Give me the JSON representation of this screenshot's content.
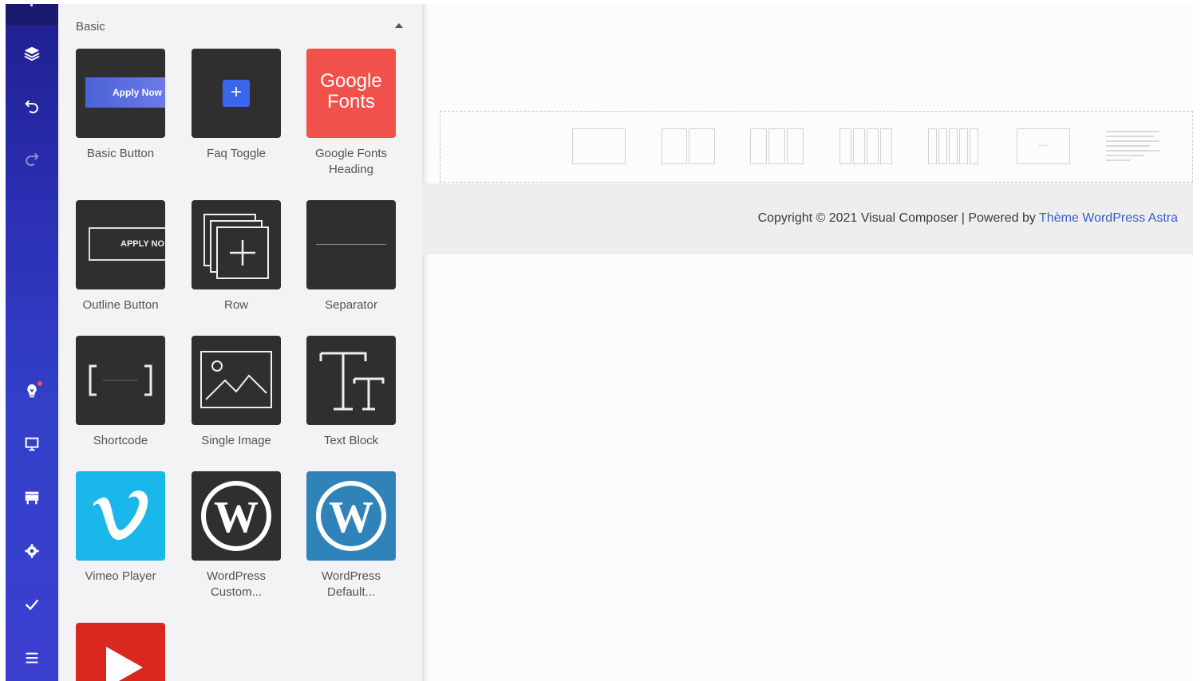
{
  "panel": {
    "section_title": "Basic",
    "elements": [
      {
        "label": "Basic Button",
        "thumb_text": "Apply Now"
      },
      {
        "label": "Faq Toggle",
        "thumb_text": "+"
      },
      {
        "label": "Google Fonts Heading",
        "thumb_text_line1": "Google",
        "thumb_text_line2": "Fonts"
      },
      {
        "label": "Outline Button",
        "thumb_text": "APPLY NO"
      },
      {
        "label": "Row"
      },
      {
        "label": "Separator"
      },
      {
        "label": "Shortcode"
      },
      {
        "label": "Single Image"
      },
      {
        "label": "Text Block"
      },
      {
        "label": "Vimeo Player"
      },
      {
        "label": "WordPress Custom..."
      },
      {
        "label": "WordPress Default..."
      },
      {
        "label": ""
      }
    ]
  },
  "navbar": {
    "icons": [
      "layers-icon",
      "undo-icon",
      "redo-icon",
      "lightbulb-icon",
      "desktop-icon",
      "shop-icon",
      "settings-icon",
      "check-icon",
      "menu-icon"
    ]
  },
  "canvas": {
    "footer": {
      "text": "Copyright © 2021 Visual Composer | Powered by ",
      "link": "Thème WordPress Astra"
    },
    "layout_options": [
      "1 column",
      "2 columns",
      "3 columns",
      "4 columns",
      "5 columns",
      "custom",
      "text block"
    ],
    "custom_layout_glyph": "···"
  },
  "colors": {
    "navbar": "#2b2fb3",
    "google_fonts_tile": "#f0514a",
    "vimeo_tile": "#1ab7ea",
    "wordpress_default_tile": "#2f83b9",
    "youtube_tile": "#d9281f",
    "link": "#3a5fcd"
  }
}
